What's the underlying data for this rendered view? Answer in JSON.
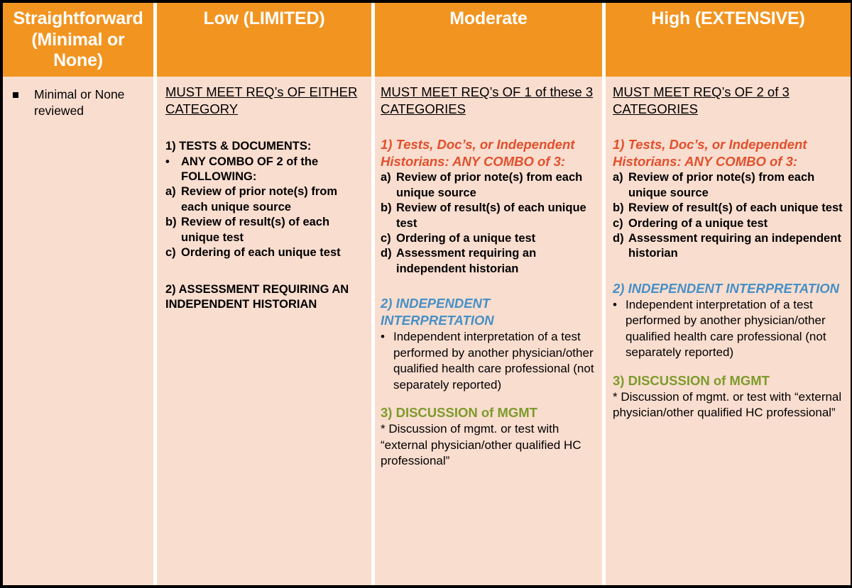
{
  "table": {
    "headers": [
      {
        "label": "Straightforward (Minimal or None)",
        "key": "straightforward"
      },
      {
        "label": "Low (LIMITED)",
        "key": "low"
      },
      {
        "label": "Moderate",
        "key": "moderate"
      },
      {
        "label": "High (EXTENSIVE)",
        "key": "high"
      }
    ],
    "colors": {
      "header_background": "#F29420",
      "header_text": "#FFFFFF",
      "body_background": "#F9DDCF",
      "body_text": "#000000",
      "accent_orange": "#E24F2C",
      "accent_blue": "#4690C6",
      "accent_green": "#7D9B2C",
      "border": "#000000"
    },
    "columns": {
      "straightforward": {
        "bullet_marker": "square-bullet",
        "bullet_text": "Minimal or None reviewed"
      },
      "low": {
        "requirement_heading": "MUST MEET REQ’s OF EITHER CATEGORY",
        "section1_title": "1)   TESTS & DOCUMENTS:",
        "section1_subtitle_marker": "•",
        "section1_subtitle": "ANY COMBO OF 2 of the FOLLOWING:",
        "section1_items": [
          {
            "marker": "a)",
            "text": "Review of prior note(s) from each unique source"
          },
          {
            "marker": "b)",
            "text": "Review of result(s) of each unique test"
          },
          {
            "marker": "c)",
            "text": "Ordering of each unique test"
          }
        ],
        "section2_title": "2) ASSESSMENT REQUIRING AN INDEPENDENT HISTORIAN"
      },
      "moderate": {
        "requirement_heading": "MUST MEET REQ’s OF 1 of these 3 CATEGORIES",
        "section1_title": "1) Tests, Doc’s, or Independent Historians: ANY COMBO of 3:",
        "section1_items": [
          {
            "marker": "a)",
            "text": "Review of prior note(s) from each unique source"
          },
          {
            "marker": "b)",
            "text": "Review of result(s) of each unique test"
          },
          {
            "marker": "c)",
            "text": "Ordering of a unique test"
          },
          {
            "marker": "d)",
            "text": "Assessment requiring an independent historian"
          }
        ],
        "section2_title": "2) INDEPENDENT INTERPRETATION",
        "section2_items": [
          {
            "marker": "•",
            "text": "Independent interpretation of a test performed by another physician/other qualified health care professional (not separately reported)"
          }
        ],
        "section3_title": "3) DISCUSSION of MGMT",
        "section3_text": "*  Discussion of mgmt. or test with “external physician/other qualified HC professional”"
      },
      "high": {
        "requirement_heading": "MUST MEET REQ’s OF 2 of 3 CATEGORIES",
        "section1_title": "1) Tests, Doc’s, or Independent Historians: ANY COMBO of 3:",
        "section1_items": [
          {
            "marker": "a)",
            "text": "Review of prior note(s) from each unique source"
          },
          {
            "marker": "b)",
            "text": "Review of result(s) of each unique test"
          },
          {
            "marker": "c)",
            "text": "Ordering of a unique test"
          },
          {
            "marker": "d)",
            "text": "Assessment requiring an independent historian"
          }
        ],
        "section2_title": "2) INDEPENDENT INTERPRETATION",
        "section2_items": [
          {
            "marker": "•",
            "text": "Independent interpretation of a test performed by another physician/other qualified health care professional (not separately reported)"
          }
        ],
        "section3_title": "3) DISCUSSION of MGMT",
        "section3_text": "*  Discussion of mgmt. or test with “external physician/other qualified HC professional”"
      }
    }
  }
}
